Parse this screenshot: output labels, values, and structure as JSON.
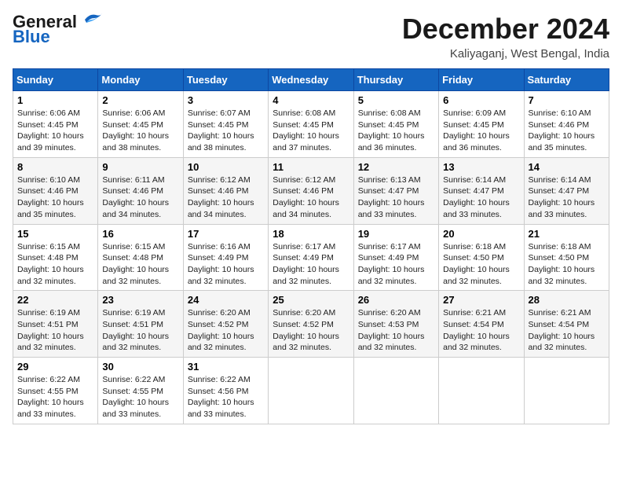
{
  "logo": {
    "line1": "General",
    "line2": "Blue"
  },
  "title": "December 2024",
  "location": "Kaliyaganj, West Bengal, India",
  "headers": [
    "Sunday",
    "Monday",
    "Tuesday",
    "Wednesday",
    "Thursday",
    "Friday",
    "Saturday"
  ],
  "weeks": [
    [
      {
        "day": "1",
        "sunrise": "6:06 AM",
        "sunset": "4:45 PM",
        "daylight": "10 hours and 39 minutes."
      },
      {
        "day": "2",
        "sunrise": "6:06 AM",
        "sunset": "4:45 PM",
        "daylight": "10 hours and 38 minutes."
      },
      {
        "day": "3",
        "sunrise": "6:07 AM",
        "sunset": "4:45 PM",
        "daylight": "10 hours and 38 minutes."
      },
      {
        "day": "4",
        "sunrise": "6:08 AM",
        "sunset": "4:45 PM",
        "daylight": "10 hours and 37 minutes."
      },
      {
        "day": "5",
        "sunrise": "6:08 AM",
        "sunset": "4:45 PM",
        "daylight": "10 hours and 36 minutes."
      },
      {
        "day": "6",
        "sunrise": "6:09 AM",
        "sunset": "4:45 PM",
        "daylight": "10 hours and 36 minutes."
      },
      {
        "day": "7",
        "sunrise": "6:10 AM",
        "sunset": "4:46 PM",
        "daylight": "10 hours and 35 minutes."
      }
    ],
    [
      {
        "day": "8",
        "sunrise": "6:10 AM",
        "sunset": "4:46 PM",
        "daylight": "10 hours and 35 minutes."
      },
      {
        "day": "9",
        "sunrise": "6:11 AM",
        "sunset": "4:46 PM",
        "daylight": "10 hours and 34 minutes."
      },
      {
        "day": "10",
        "sunrise": "6:12 AM",
        "sunset": "4:46 PM",
        "daylight": "10 hours and 34 minutes."
      },
      {
        "day": "11",
        "sunrise": "6:12 AM",
        "sunset": "4:46 PM",
        "daylight": "10 hours and 34 minutes."
      },
      {
        "day": "12",
        "sunrise": "6:13 AM",
        "sunset": "4:47 PM",
        "daylight": "10 hours and 33 minutes."
      },
      {
        "day": "13",
        "sunrise": "6:14 AM",
        "sunset": "4:47 PM",
        "daylight": "10 hours and 33 minutes."
      },
      {
        "day": "14",
        "sunrise": "6:14 AM",
        "sunset": "4:47 PM",
        "daylight": "10 hours and 33 minutes."
      }
    ],
    [
      {
        "day": "15",
        "sunrise": "6:15 AM",
        "sunset": "4:48 PM",
        "daylight": "10 hours and 32 minutes."
      },
      {
        "day": "16",
        "sunrise": "6:15 AM",
        "sunset": "4:48 PM",
        "daylight": "10 hours and 32 minutes."
      },
      {
        "day": "17",
        "sunrise": "6:16 AM",
        "sunset": "4:49 PM",
        "daylight": "10 hours and 32 minutes."
      },
      {
        "day": "18",
        "sunrise": "6:17 AM",
        "sunset": "4:49 PM",
        "daylight": "10 hours and 32 minutes."
      },
      {
        "day": "19",
        "sunrise": "6:17 AM",
        "sunset": "4:49 PM",
        "daylight": "10 hours and 32 minutes."
      },
      {
        "day": "20",
        "sunrise": "6:18 AM",
        "sunset": "4:50 PM",
        "daylight": "10 hours and 32 minutes."
      },
      {
        "day": "21",
        "sunrise": "6:18 AM",
        "sunset": "4:50 PM",
        "daylight": "10 hours and 32 minutes."
      }
    ],
    [
      {
        "day": "22",
        "sunrise": "6:19 AM",
        "sunset": "4:51 PM",
        "daylight": "10 hours and 32 minutes."
      },
      {
        "day": "23",
        "sunrise": "6:19 AM",
        "sunset": "4:51 PM",
        "daylight": "10 hours and 32 minutes."
      },
      {
        "day": "24",
        "sunrise": "6:20 AM",
        "sunset": "4:52 PM",
        "daylight": "10 hours and 32 minutes."
      },
      {
        "day": "25",
        "sunrise": "6:20 AM",
        "sunset": "4:52 PM",
        "daylight": "10 hours and 32 minutes."
      },
      {
        "day": "26",
        "sunrise": "6:20 AM",
        "sunset": "4:53 PM",
        "daylight": "10 hours and 32 minutes."
      },
      {
        "day": "27",
        "sunrise": "6:21 AM",
        "sunset": "4:54 PM",
        "daylight": "10 hours and 32 minutes."
      },
      {
        "day": "28",
        "sunrise": "6:21 AM",
        "sunset": "4:54 PM",
        "daylight": "10 hours and 32 minutes."
      }
    ],
    [
      {
        "day": "29",
        "sunrise": "6:22 AM",
        "sunset": "4:55 PM",
        "daylight": "10 hours and 33 minutes."
      },
      {
        "day": "30",
        "sunrise": "6:22 AM",
        "sunset": "4:55 PM",
        "daylight": "10 hours and 33 minutes."
      },
      {
        "day": "31",
        "sunrise": "6:22 AM",
        "sunset": "4:56 PM",
        "daylight": "10 hours and 33 minutes."
      },
      null,
      null,
      null,
      null
    ]
  ],
  "labels": {
    "sunrise_prefix": "Sunrise: ",
    "sunset_prefix": "Sunset: ",
    "daylight_prefix": "Daylight: "
  }
}
